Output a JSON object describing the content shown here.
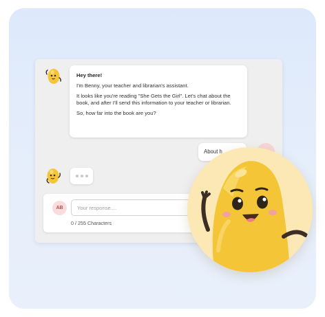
{
  "chat": {
    "bot_message": {
      "greeting": "Hey there!",
      "line1": "I'm Benny, your teacher and librarian's assistant.",
      "line2": "It looks like you're reading \"She Gets the Girl\". Let's chat about the book, and after I'll send this information to your teacher or librarian.",
      "line3": "So, how far into the book are you?"
    },
    "user_reply_partial": "About h",
    "user_initials": "AB",
    "response_placeholder": "Your response....",
    "char_counter": "0 / 255 Characters"
  },
  "colors": {
    "background": "#dde9fb",
    "mascot_yellow": "#f4c637",
    "avatar_pink": "#fbdcdc",
    "avatar_text": "#c94b4b"
  },
  "icons": {
    "bot_avatar": "benny-mascot-icon",
    "typing": "typing-dots-icon",
    "hero": "benny-waving-illustration"
  }
}
